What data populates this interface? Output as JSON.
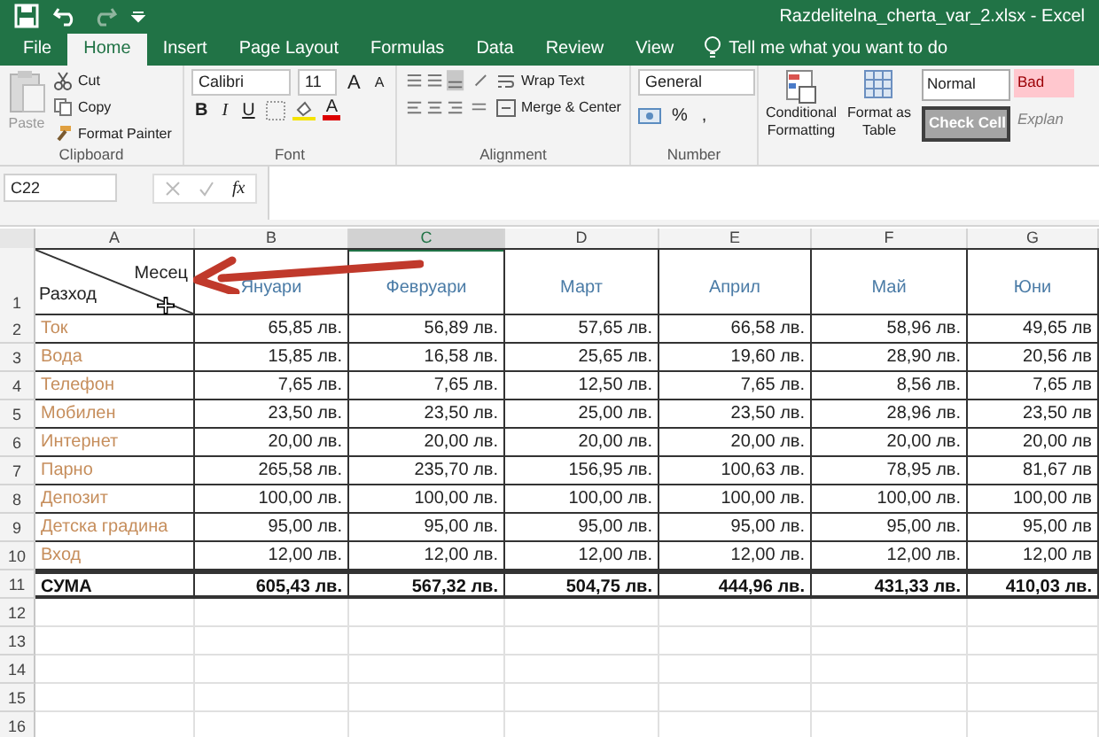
{
  "window": {
    "title": "Razdelitelna_cherta_var_2.xlsx - Excel"
  },
  "tabs": [
    {
      "label": "File",
      "selected": false
    },
    {
      "label": "Home",
      "selected": true
    },
    {
      "label": "Insert",
      "selected": false
    },
    {
      "label": "Page Layout",
      "selected": false
    },
    {
      "label": "Formulas",
      "selected": false
    },
    {
      "label": "Data",
      "selected": false
    },
    {
      "label": "Review",
      "selected": false
    },
    {
      "label": "View",
      "selected": false
    }
  ],
  "tell_me": "Tell me what you want to do",
  "clipboard": {
    "label": "Clipboard",
    "paste": "Paste",
    "cut": "Cut",
    "copy": "Copy",
    "format_painter": "Format Painter"
  },
  "font": {
    "label": "Font",
    "family": "Calibri",
    "size": "11",
    "grow": "A",
    "shrink": "A",
    "bold": "B",
    "italic": "I",
    "underline": "U",
    "text_color_glyph": "A"
  },
  "alignment": {
    "label": "Alignment",
    "wrap_text": "Wrap Text",
    "merge_center": "Merge & Center"
  },
  "number": {
    "label": "Number",
    "format": "General",
    "percent": "%",
    "comma": ","
  },
  "styles": {
    "conditional_formatting": "Conditional Formatting",
    "format_as_table": "Format as Table",
    "cell_styles": [
      {
        "label": "Normal",
        "kind": "normal"
      },
      {
        "label": "Bad",
        "kind": "bad"
      },
      {
        "label": "Check Cell",
        "kind": "check"
      },
      {
        "label": "Explan",
        "kind": "explanatory"
      }
    ]
  },
  "name_box": "C22",
  "formula_icon": "fx",
  "columns": [
    {
      "label": "A",
      "selected": false
    },
    {
      "label": "B",
      "selected": false
    },
    {
      "label": "C",
      "selected": true
    },
    {
      "label": "D",
      "selected": false
    },
    {
      "label": "E",
      "selected": false
    },
    {
      "label": "F",
      "selected": false
    },
    {
      "label": "G",
      "selected": false
    }
  ],
  "header_row": {
    "number": "1",
    "top": "Месец",
    "bottom": "Разход",
    "months": [
      "Януари",
      "Февруари",
      "Март",
      "Април",
      "Май",
      "Юни"
    ]
  },
  "rows": [
    {
      "number": "2",
      "label": "Ток",
      "values": [
        "65,85 лв.",
        "56,89 лв.",
        "57,65 лв.",
        "66,58 лв.",
        "58,96 лв.",
        "49,65 лв"
      ]
    },
    {
      "number": "3",
      "label": "Вода",
      "values": [
        "15,85 лв.",
        "16,58 лв.",
        "25,65 лв.",
        "19,60 лв.",
        "28,90 лв.",
        "20,56 лв"
      ]
    },
    {
      "number": "4",
      "label": "Телефон",
      "values": [
        "7,65 лв.",
        "7,65 лв.",
        "12,50 лв.",
        "7,65 лв.",
        "8,56 лв.",
        "7,65 лв"
      ]
    },
    {
      "number": "5",
      "label": "Мобилен",
      "values": [
        "23,50 лв.",
        "23,50 лв.",
        "25,00 лв.",
        "23,50 лв.",
        "28,96 лв.",
        "23,50 лв"
      ]
    },
    {
      "number": "6",
      "label": "Интернет",
      "values": [
        "20,00 лв.",
        "20,00 лв.",
        "20,00 лв.",
        "20,00 лв.",
        "20,00 лв.",
        "20,00 лв"
      ]
    },
    {
      "number": "7",
      "label": "Парно",
      "values": [
        "265,58 лв.",
        "235,70 лв.",
        "156,95 лв.",
        "100,63 лв.",
        "78,95 лв.",
        "81,67 лв"
      ]
    },
    {
      "number": "8",
      "label": "Депозит",
      "values": [
        "100,00 лв.",
        "100,00 лв.",
        "100,00 лв.",
        "100,00 лв.",
        "100,00 лв.",
        "100,00 лв"
      ]
    },
    {
      "number": "9",
      "label": "Детска градина",
      "values": [
        "95,00 лв.",
        "95,00 лв.",
        "95,00 лв.",
        "95,00 лв.",
        "95,00 лв.",
        "95,00 лв"
      ]
    },
    {
      "number": "10",
      "label": "Вход",
      "values": [
        "12,00 лв.",
        "12,00 лв.",
        "12,00 лв.",
        "12,00 лв.",
        "12,00 лв.",
        "12,00 лв"
      ]
    }
  ],
  "total": {
    "number": "11",
    "label": "СУМА",
    "values": [
      "605,43 лв.",
      "567,32 лв.",
      "504,75 лв.",
      "444,96 лв.",
      "431,33 лв.",
      "410,03 лв."
    ]
  },
  "empty_rows": [
    "12",
    "13",
    "14",
    "15",
    "16"
  ]
}
